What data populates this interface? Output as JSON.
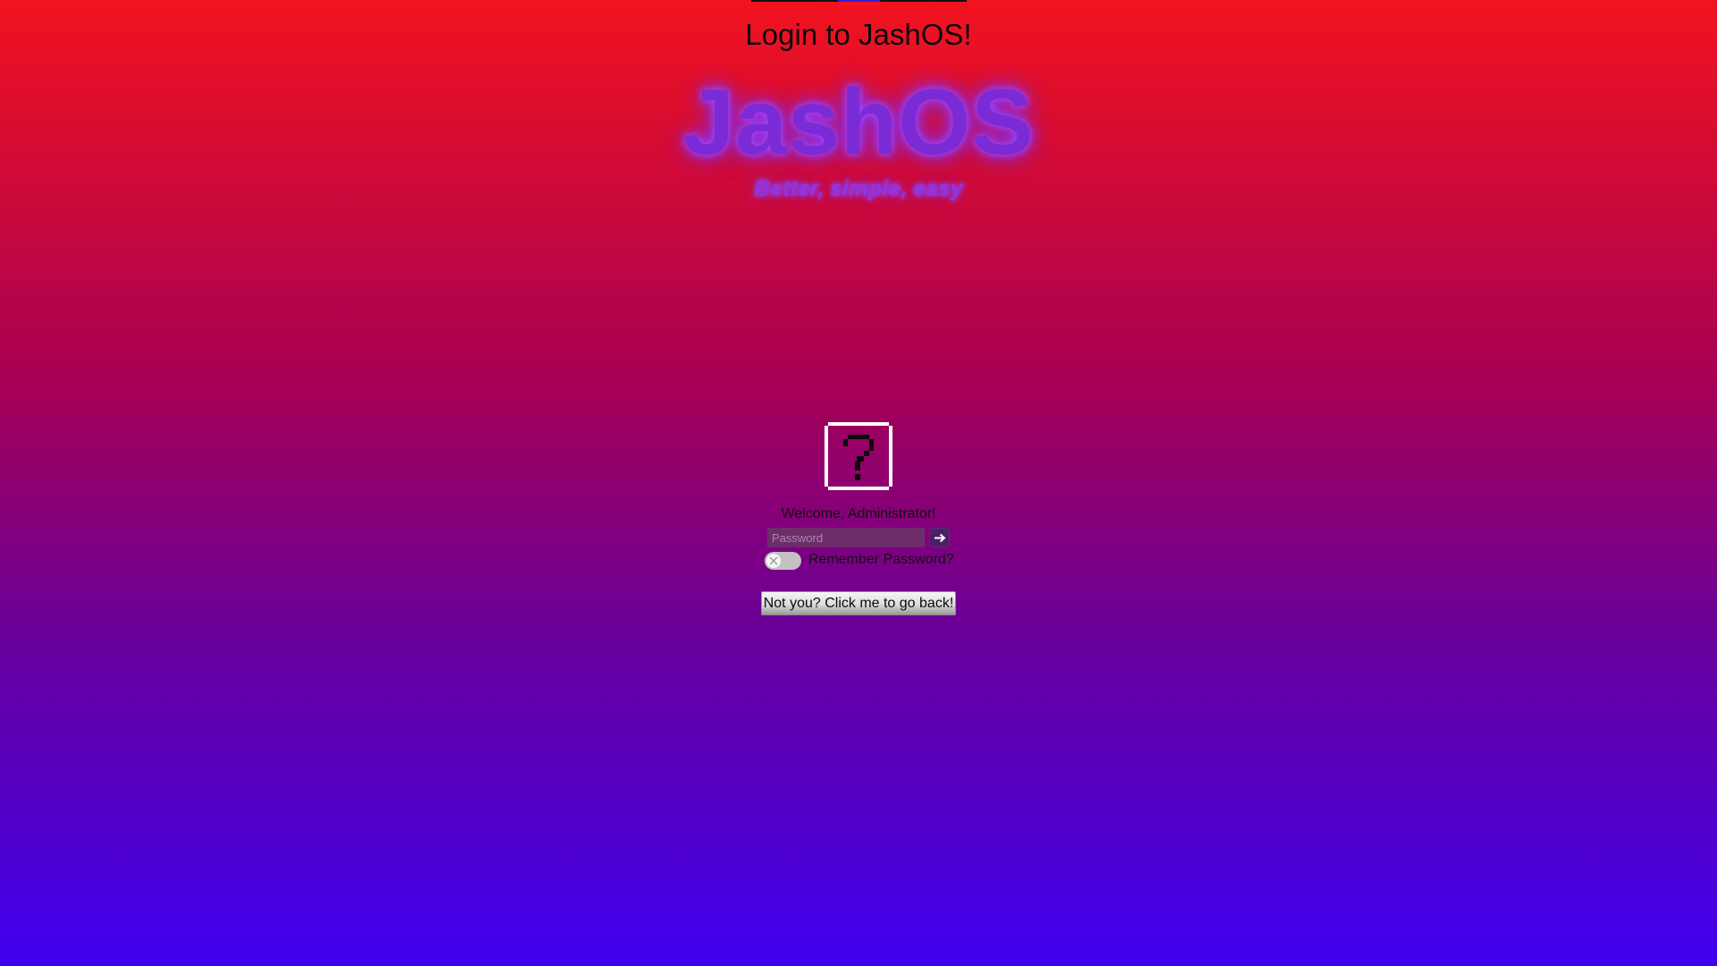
{
  "header": {
    "title": "Login to JashOS!"
  },
  "brand": {
    "logo_text": "JashOS",
    "tagline": "Better, simple, easy"
  },
  "user": {
    "avatar_icon": "question-mark-icon",
    "welcome_text": "Welcome, Administrator!"
  },
  "login_form": {
    "password_value": "",
    "password_placeholder": "Password",
    "submit_icon": "arrow-right-icon",
    "remember_label": "Remember Password?",
    "remember_enabled": false,
    "toggle_icon": "x-icon",
    "back_button_label": "Not you? Click me to go back!"
  },
  "colors": {
    "background_top": "#f2131f",
    "background_mid": "#a60055",
    "background_bottom": "#3f00f0",
    "logo_glow": "#7a2bd6",
    "password_field": "#6e2c6a"
  }
}
